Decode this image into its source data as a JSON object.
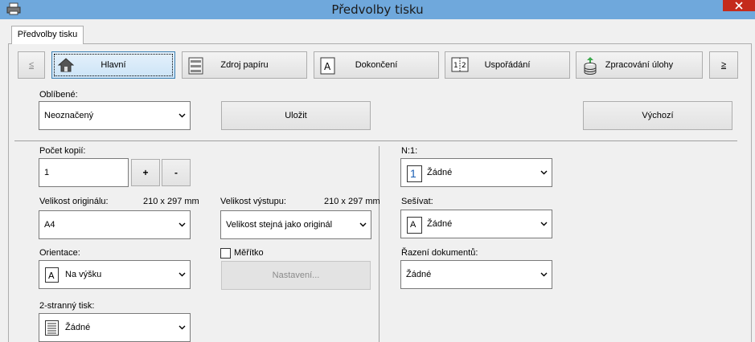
{
  "window": {
    "title": "Předvolby tisku"
  },
  "tabs": [
    {
      "label": "Předvolby tisku"
    }
  ],
  "nav": {
    "prev": "≤",
    "next": "≥",
    "items": [
      {
        "label": "Hlavní",
        "icon": "home-icon"
      },
      {
        "label": "Zdroj papíru",
        "icon": "printer-tray-icon"
      },
      {
        "label": "Dokončení",
        "icon": "page-a-icon"
      },
      {
        "label": "Uspořádání",
        "icon": "layout-icon"
      },
      {
        "label": "Zpracování úlohy",
        "icon": "job-stack-icon"
      }
    ]
  },
  "favorites": {
    "label": "Oblíbené:",
    "value": "Neoznačený"
  },
  "buttons": {
    "save": "Uložit",
    "default": "Výchozí",
    "settings": "Nastavení..."
  },
  "copies": {
    "label": "Počet kopií:",
    "value": "1",
    "plus": "+",
    "minus": "-"
  },
  "original_size": {
    "label": "Velikost originálu:",
    "dims": "210 x 297 mm",
    "value": "A4"
  },
  "output_size": {
    "label": "Velikost výstupu:",
    "dims": "210 x 297 mm",
    "value": "Velikost stejná jako originál"
  },
  "orientation": {
    "label": "Orientace:",
    "value": "Na výšku"
  },
  "scale": {
    "label": "Měřítko",
    "checked": false
  },
  "duplex": {
    "label": "2-stranný tisk:",
    "value": "Žádné"
  },
  "nup": {
    "label": "N:1:",
    "value": "Žádné",
    "icon_text": "1"
  },
  "staple": {
    "label": "Sešívat:",
    "value": "Žádné",
    "icon_text": "A"
  },
  "collate": {
    "label": "Řazení dokumentů:",
    "value": "Žádné"
  },
  "colors": {
    "titlebar": "#6fa8dc",
    "close": "#c42b1c",
    "accent": "#3c7fb1"
  }
}
